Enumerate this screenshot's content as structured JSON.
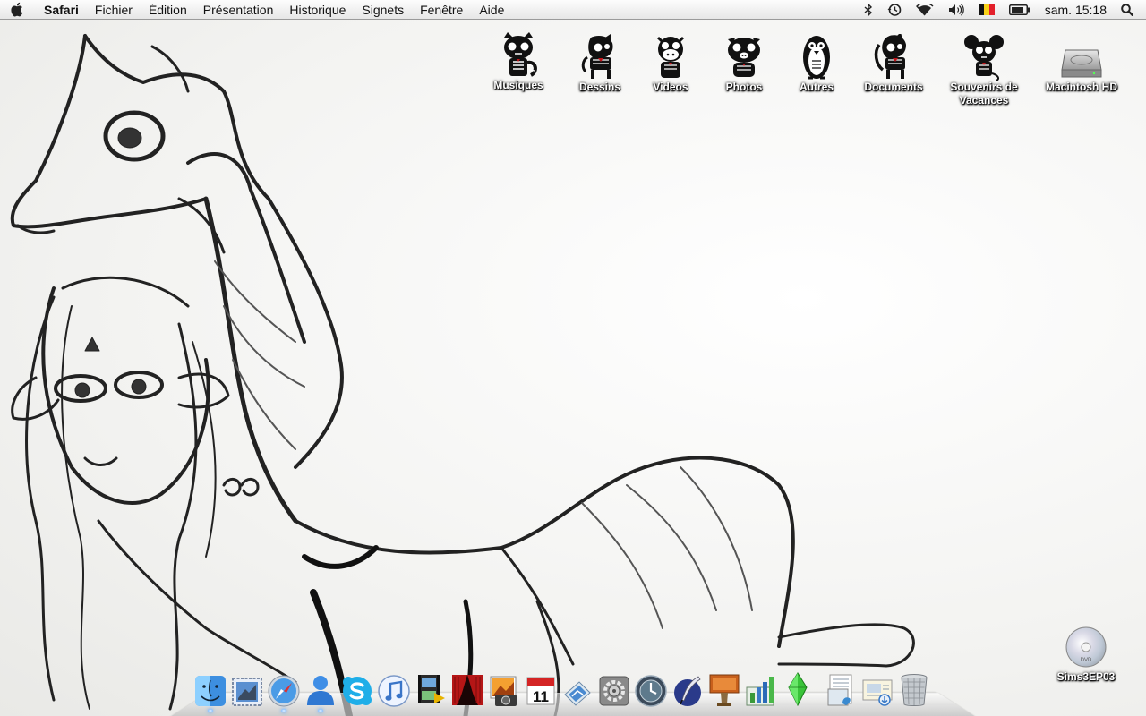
{
  "menubar": {
    "apple_icon": "apple-logo-icon",
    "app_name": "Safari",
    "menus": [
      "Fichier",
      "Édition",
      "Présentation",
      "Historique",
      "Signets",
      "Fenêtre",
      "Aide"
    ],
    "status_icons": [
      "bluetooth-icon",
      "time-machine-icon",
      "wifi-icon",
      "volume-icon",
      "belgian-flag-icon",
      "battery-icon"
    ],
    "clock": "sam. 15:18",
    "spotlight_icon": "spotlight-search-icon"
  },
  "desktop": {
    "folders": [
      {
        "label": "Musiques",
        "icon": "skull-raccoon-folder-icon"
      },
      {
        "label": "Dessins",
        "icon": "skull-pony-folder-icon"
      },
      {
        "label": "Videos",
        "icon": "skull-cow-folder-icon"
      },
      {
        "label": "Photos",
        "icon": "skull-pig-folder-icon"
      },
      {
        "label": "Autres",
        "icon": "skull-penguin-folder-icon"
      },
      {
        "label": "Documents",
        "icon": "skull-pony-folder-icon"
      },
      {
        "label": "Souvenirs de Vacances",
        "icon": "skull-mouse-folder-icon"
      }
    ],
    "drives": [
      {
        "label": "Macintosh HD",
        "icon": "hard-drive-icon"
      },
      {
        "label": "Sims3EP03",
        "icon": "dvd-disc-icon"
      }
    ]
  },
  "dock": {
    "items": [
      {
        "name": "Finder",
        "icon": "finder-icon",
        "running": true
      },
      {
        "name": "Mail",
        "icon": "mail-stamp-icon",
        "running": false
      },
      {
        "name": "Safari",
        "icon": "safari-compass-icon",
        "running": true
      },
      {
        "name": "iChat",
        "icon": "ichat-buddy-icon",
        "running": true
      },
      {
        "name": "Skype",
        "icon": "skype-icon",
        "running": false
      },
      {
        "name": "iTunes",
        "icon": "itunes-note-icon",
        "running": false
      },
      {
        "name": "iMovie",
        "icon": "imovie-film-icon",
        "running": false
      },
      {
        "name": "Front Row",
        "icon": "front-row-curtain-icon",
        "running": false
      },
      {
        "name": "iPhoto",
        "icon": "iphoto-icon",
        "running": false
      },
      {
        "name": "iCal",
        "icon": "ical-calendar-icon",
        "running": false,
        "day": "11"
      },
      {
        "name": "Aperçu",
        "icon": "preview-icon",
        "running": false
      },
      {
        "name": "Préférences Système",
        "icon": "system-preferences-gear-icon",
        "running": false
      },
      {
        "name": "Time Machine",
        "icon": "time-machine-dock-icon",
        "running": false
      },
      {
        "name": "Plume",
        "icon": "quill-pen-icon",
        "running": false
      },
      {
        "name": "Keynote",
        "icon": "keynote-podium-icon",
        "running": false
      },
      {
        "name": "Numbers",
        "icon": "numbers-chart-icon",
        "running": false
      },
      {
        "name": "Les Sims 3",
        "icon": "sims-plumbob-icon",
        "running": false
      },
      {
        "name": "Documents",
        "icon": "documents-stack-icon",
        "running": false
      },
      {
        "name": "Téléchargements",
        "icon": "downloads-stack-icon",
        "running": false
      },
      {
        "name": "Corbeille",
        "icon": "trash-icon",
        "running": false
      }
    ]
  },
  "colors": {
    "menubar_top": "#fdfdfd",
    "menubar_bottom": "#e6e6e6",
    "label_text": "#ffffff",
    "wallpaper": "#f4f4f2",
    "running_indicator": "#5aa7ff"
  }
}
